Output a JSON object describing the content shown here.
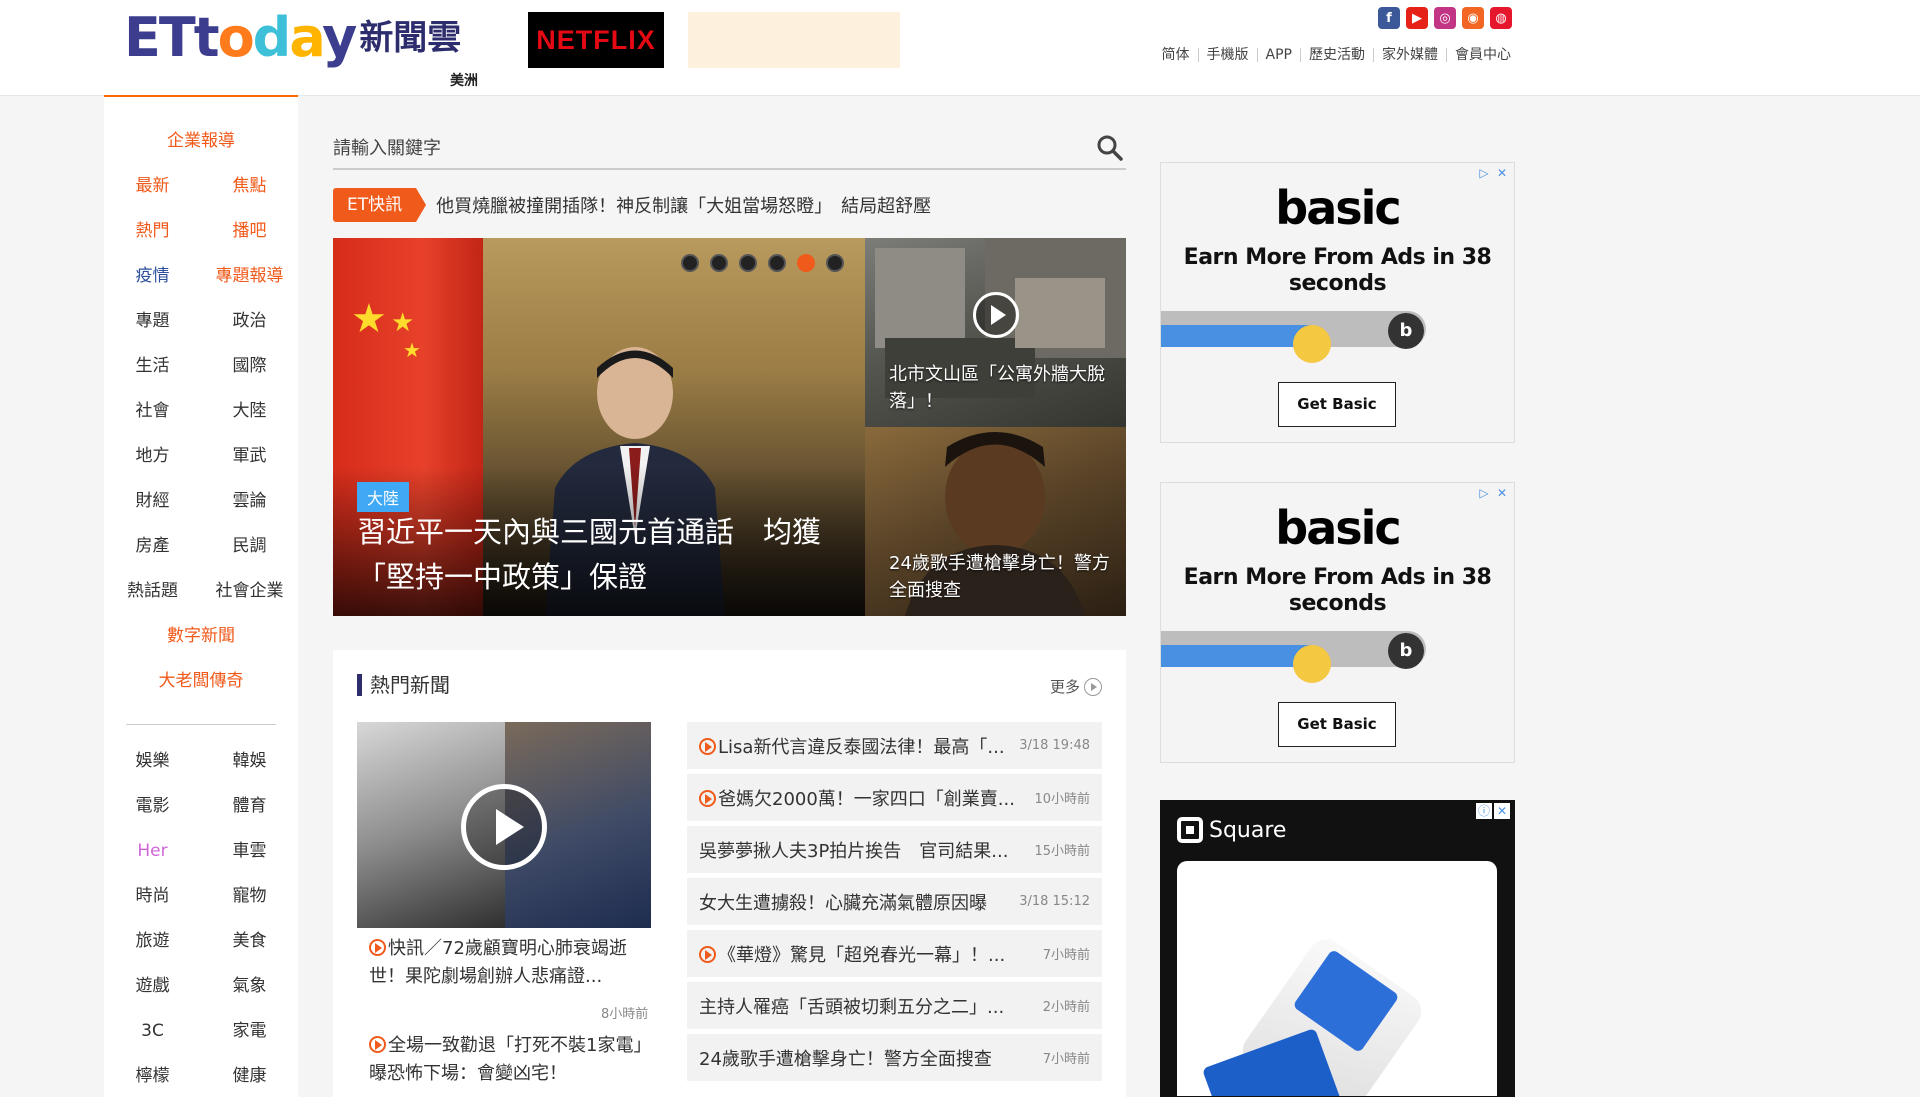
{
  "header": {
    "logo_text": "ETtoday",
    "logo_cn": "新聞雲",
    "region": "美洲",
    "netflix": "NETFLIX",
    "social": [
      {
        "name": "facebook-icon",
        "glyph": "f",
        "color": "#3b5998"
      },
      {
        "name": "youtube-icon",
        "glyph": "▶",
        "color": "#e62117"
      },
      {
        "name": "instagram-icon",
        "glyph": "◎",
        "color": "#c13584"
      },
      {
        "name": "rss-icon",
        "glyph": "◉",
        "color": "#f26522"
      },
      {
        "name": "weibo-icon",
        "glyph": "◍",
        "color": "#e6162d"
      }
    ],
    "links": [
      "简体",
      "手機版",
      "APP",
      "歷史活動",
      "家外媒體",
      "會員中心"
    ]
  },
  "leftnav": {
    "top_single": "企業報導",
    "rows": [
      [
        {
          "label": "最新",
          "color": "orange"
        },
        {
          "label": "焦點",
          "color": "orange"
        }
      ],
      [
        {
          "label": "熱門",
          "color": "orange"
        },
        {
          "label": "播吧",
          "color": "orange"
        }
      ],
      [
        {
          "label": "疫情",
          "color": "navy"
        },
        {
          "label": "專題報導",
          "color": "orange"
        }
      ],
      [
        {
          "label": "專題",
          "color": "default"
        },
        {
          "label": "政治",
          "color": "default"
        }
      ],
      [
        {
          "label": "生活",
          "color": "default"
        },
        {
          "label": "國際",
          "color": "default"
        }
      ],
      [
        {
          "label": "社會",
          "color": "default"
        },
        {
          "label": "大陸",
          "color": "default"
        }
      ],
      [
        {
          "label": "地方",
          "color": "default"
        },
        {
          "label": "軍武",
          "color": "default"
        }
      ],
      [
        {
          "label": "財經",
          "color": "default"
        },
        {
          "label": "雲論",
          "color": "default"
        }
      ],
      [
        {
          "label": "房產",
          "color": "default"
        },
        {
          "label": "民調",
          "color": "default"
        }
      ],
      [
        {
          "label": "熱話題",
          "color": "default"
        },
        {
          "label": "社會企業",
          "color": "default"
        }
      ]
    ],
    "single_2": "數字新聞",
    "single_3": "大老闆傳奇",
    "rows2": [
      [
        {
          "label": "娛樂",
          "color": "default"
        },
        {
          "label": "韓娛",
          "color": "default"
        }
      ],
      [
        {
          "label": "電影",
          "color": "default"
        },
        {
          "label": "體育",
          "color": "default"
        }
      ],
      [
        {
          "label": "Her",
          "color": "purple"
        },
        {
          "label": "車雲",
          "color": "default"
        }
      ],
      [
        {
          "label": "時尚",
          "color": "default"
        },
        {
          "label": "寵物",
          "color": "default"
        }
      ],
      [
        {
          "label": "旅遊",
          "color": "default"
        },
        {
          "label": "美食",
          "color": "default"
        }
      ],
      [
        {
          "label": "遊戲",
          "color": "default"
        },
        {
          "label": "氣象",
          "color": "default"
        }
      ],
      [
        {
          "label": "3C",
          "color": "default"
        },
        {
          "label": "家電",
          "color": "default"
        }
      ],
      [
        {
          "label": "檸檬",
          "color": "default"
        },
        {
          "label": "健康",
          "color": "default"
        }
      ]
    ]
  },
  "search": {
    "placeholder": "請輸入關鍵字"
  },
  "flash": {
    "tag": "ET快訊",
    "text": "他買燒臘被撞開插隊！神反制讓「大姐當場怒瞪」　結局超舒壓"
  },
  "hero": {
    "tag": "大陸",
    "title": "習近平一天內與三國元首通話　均獲「堅持一中政策」保證",
    "dots": 6,
    "active_dot": 4,
    "side": [
      {
        "title": "北市文山區「公寓外牆大脫落」！"
      },
      {
        "title": "24歲歌手遭槍擊身亡！警方全面搜查"
      }
    ]
  },
  "hot": {
    "heading": "熱門新聞",
    "more": "更多",
    "feature": {
      "caption1": "快訊／72歲顧寶明心肺衰竭逝世！果陀劇場創辦人悲痛證...",
      "time1": "8小時前",
      "caption2": "全場一致勸退「打死不裝1家電」　曝恐怖下場：會變凶宅！"
    },
    "list": [
      {
        "title": "Lisa新代言違反泰國法律！最高「...",
        "time": "3/18 19:48",
        "video": true
      },
      {
        "title": "爸媽欠2000萬！一家四口「創業賣...",
        "time": "10小時前",
        "video": true
      },
      {
        "title": "吳夢夢揪人夫3P拍片挨告　官司結果...",
        "time": "15小時前",
        "video": false
      },
      {
        "title": "女大生遭擄殺！心臟充滿氣體原因曝",
        "time": "3/18 15:12",
        "video": false
      },
      {
        "title": "《華燈》驚見「超兇春光一幕」！...",
        "time": "7小時前",
        "video": true
      },
      {
        "title": "主持人罹癌「舌頭被切剩五分之二」...",
        "time": "2小時前",
        "video": false
      },
      {
        "title": "24歲歌手遭槍擊身亡！警方全面搜查",
        "time": "7小時前",
        "video": false
      }
    ]
  },
  "ads": {
    "basic_logo": "basic",
    "basic_tagline": "Earn More From Ads in 38 seconds",
    "basic_button": "Get Basic",
    "square_name": "Square"
  }
}
